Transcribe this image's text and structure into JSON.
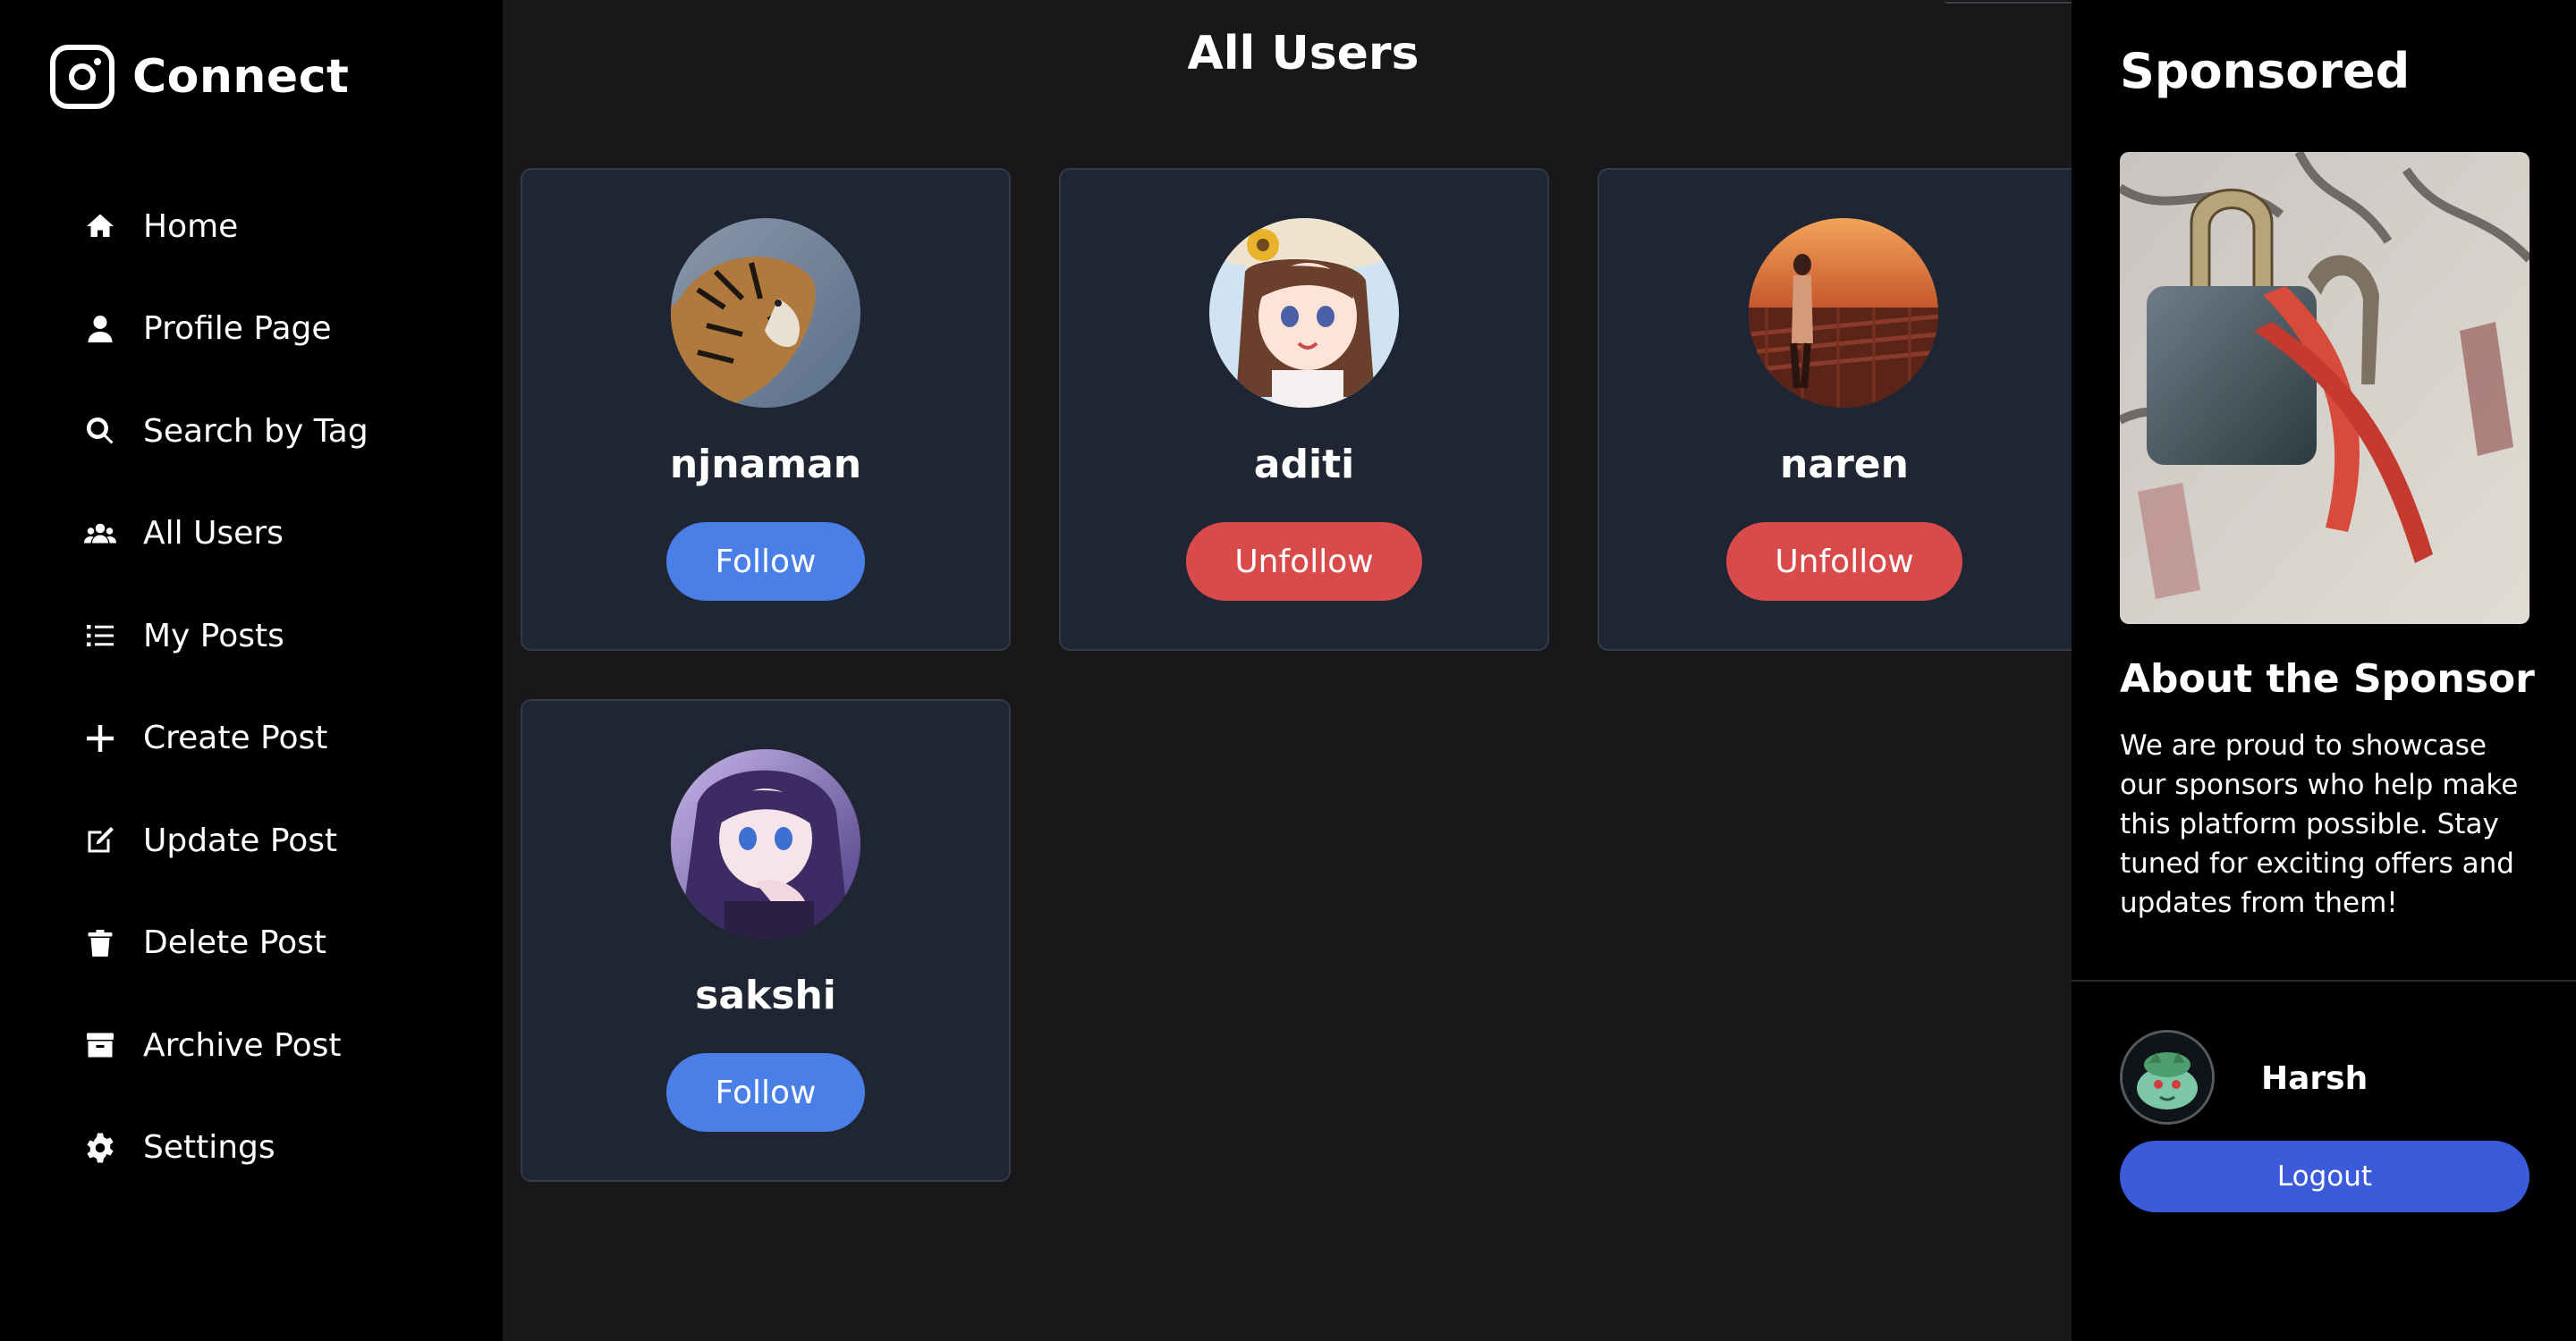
{
  "brand": {
    "name": "Connect",
    "icon": "instagram-camera-icon"
  },
  "nav": {
    "items": [
      {
        "label": "Home",
        "icon": "home-icon"
      },
      {
        "label": "Profile Page",
        "icon": "user-icon"
      },
      {
        "label": "Search by Tag",
        "icon": "search-icon"
      },
      {
        "label": "All Users",
        "icon": "users-icon"
      },
      {
        "label": "My Posts",
        "icon": "list-icon"
      },
      {
        "label": "Create Post",
        "icon": "plus-icon"
      },
      {
        "label": "Update Post",
        "icon": "edit-icon"
      },
      {
        "label": "Delete Post",
        "icon": "trash-icon"
      },
      {
        "label": "Archive Post",
        "icon": "archive-icon"
      },
      {
        "label": "Settings",
        "icon": "gear-icon"
      }
    ]
  },
  "main": {
    "title": "All Users",
    "users": [
      {
        "username": "njnaman",
        "action": "Follow",
        "action_color": "#4a7fe8"
      },
      {
        "username": "aditi",
        "action": "Unfollow",
        "action_color": "#d94a4a"
      },
      {
        "username": "naren",
        "action": "Unfollow",
        "action_color": "#d94a4a"
      },
      {
        "username": "sakshi",
        "action": "Follow",
        "action_color": "#4a7fe8"
      }
    ]
  },
  "sidebar_right": {
    "sponsored_title": "Sponsored",
    "about_title": "About the Sponsor",
    "about_text": "We are proud to showcase our sponsors who help make this platform possible. Stay tuned for exciting offers and updates from them!",
    "current_user": "Harsh",
    "logout_label": "Logout",
    "logout_color": "#3b5bdb"
  }
}
